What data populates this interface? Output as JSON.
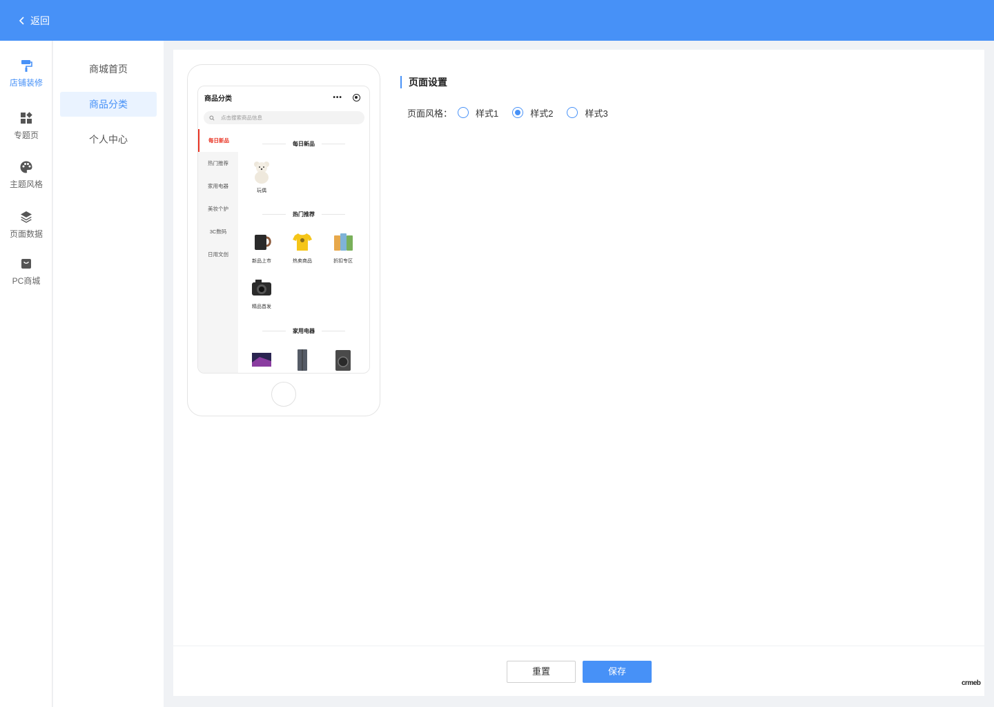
{
  "header": {
    "back_label": "返回",
    "bg_color": "#4791f7"
  },
  "left_nav": {
    "items": [
      {
        "label": "店铺装修",
        "icon": "paint-roller-icon",
        "active": true
      },
      {
        "label": "专题页",
        "icon": "widgets-icon",
        "active": false
      },
      {
        "label": "主题风格",
        "icon": "palette-icon",
        "active": false
      },
      {
        "label": "页面数据",
        "icon": "layers-icon",
        "active": false
      },
      {
        "label": "PC商城",
        "icon": "shop-bag-icon",
        "active": false
      }
    ]
  },
  "sub_nav": {
    "items": [
      {
        "label": "商城首页",
        "active": false
      },
      {
        "label": "商品分类",
        "active": true
      },
      {
        "label": "个人中心",
        "active": false
      }
    ]
  },
  "phone": {
    "title": "商品分类",
    "capsule_dots": "•••",
    "search_placeholder": "点击搜索商品信息",
    "categories": [
      "每日新品",
      "热门推荐",
      "家用电器",
      "美妆个护",
      "3C数码",
      "日用文创"
    ],
    "active_category": "每日新品",
    "sections": [
      {
        "title": "每日新品",
        "products": [
          {
            "name": "玩偶",
            "icon": "teddy-bear-icon"
          }
        ]
      },
      {
        "title": "热门推荐",
        "products": [
          {
            "name": "新品上市",
            "icon": "mug-icon"
          },
          {
            "name": "热卖商品",
            "icon": "tshirt-icon"
          },
          {
            "name": "折扣专区",
            "icon": "snack-packs-icon"
          },
          {
            "name": "精品首发",
            "icon": "camera-icon"
          }
        ]
      },
      {
        "title": "家用电器",
        "products": [
          {
            "name": "",
            "icon": "tv-icon"
          },
          {
            "name": "",
            "icon": "fridge-icon"
          },
          {
            "name": "",
            "icon": "washing-machine-icon"
          }
        ]
      }
    ]
  },
  "settings": {
    "title": "页面设置",
    "style_label": "页面风格：",
    "options": [
      "样式1",
      "样式2",
      "样式3"
    ],
    "selected": "样式2"
  },
  "footer": {
    "reset_label": "重置",
    "save_label": "保存"
  },
  "watermark": "crmeb"
}
